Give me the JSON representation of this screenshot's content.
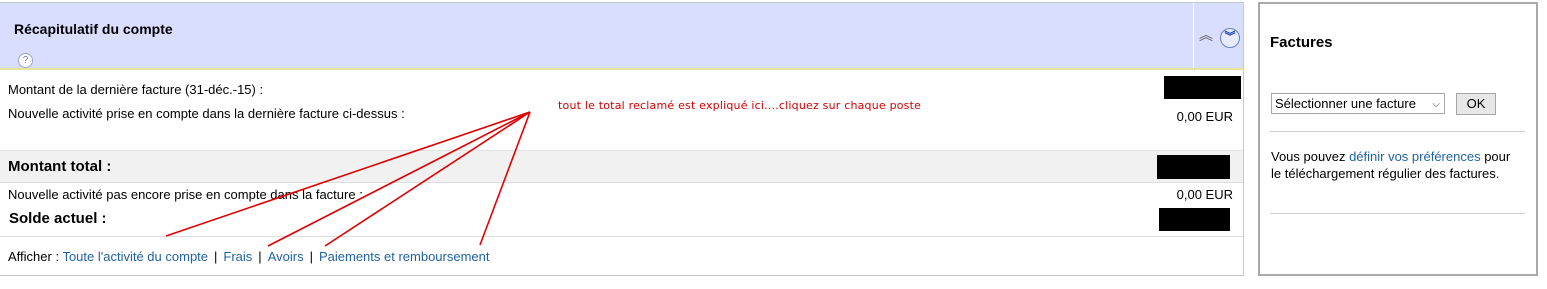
{
  "account_summary": {
    "title": "Récapitulatif du compte",
    "help_icon": "?",
    "last_invoice_label": "Montant de la dernière facture  (31-déc.-15)  :",
    "new_activity_label": "Nouvelle activité prise en compte dans la dernière facture ci-dessus :",
    "new_activity_amount": "0,00 EUR",
    "total_label": "Montant total :",
    "pending_activity_label": "Nouvelle activité pas encore prise en compte dans la facture :",
    "pending_activity_amount": "0,00 EUR",
    "current_balance_label": "Solde actuel :",
    "filters": {
      "prefix": "Afficher :",
      "links": [
        "Toute l'activité du compte",
        "Frais",
        "Avoirs",
        "Paiements et remboursement"
      ],
      "separator": "|"
    }
  },
  "annotation": {
    "text": "tout le total reclamé est expliqué ici....cliquez sur chaque poste",
    "color": "#d60000"
  },
  "invoices_panel": {
    "title": "Factures",
    "select_value": "Sélectionner une facture",
    "ok_label": "OK",
    "info_prefix": "Vous pouvez ",
    "info_link": "définir vos préférences",
    "info_suffix": " pour le téléchargement régulier des factures."
  },
  "icons": {
    "collapse": "double-chevron-up-icon",
    "expand": "double-chevron-down-circle-icon",
    "help": "help-circle-icon"
  },
  "colors": {
    "header_bg": "#d9deff",
    "link": "#1f62a3"
  }
}
